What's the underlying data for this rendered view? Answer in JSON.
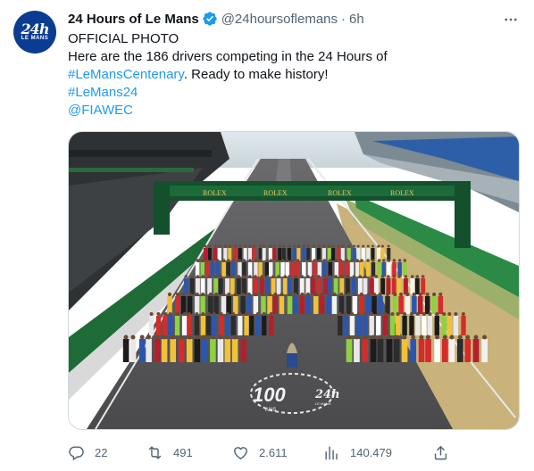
{
  "account": {
    "display_name": "24 Hours of Le Mans",
    "handle": "@24hoursoflemans",
    "separator": "·",
    "time": "6h",
    "avatar_text": "24h",
    "avatar_subtext": "LE MANS",
    "verified": true
  },
  "tweet": {
    "line1": "OFFICIAL PHOTO",
    "line2": "Here are the 186 drivers competing in the 24 Hours of",
    "hashtag_centenary": "#LeMansCentenary",
    "line3_rest": ". Ready to make history!",
    "hashtag_lemans24": "#LeMans24",
    "mention": "@FIAWEC"
  },
  "media": {
    "gantry_text": "ROLEX",
    "logo_number": "100",
    "logo_sub": "ANS",
    "logo_brand": "24h",
    "logo_brand_sub": "LE MANS"
  },
  "actions": {
    "replies": "22",
    "retweets": "491",
    "likes": "2.611",
    "views": "140.479"
  },
  "colors": {
    "link": "#1d9bf0",
    "secondary_text": "#536471",
    "verified": "#1d9bf0",
    "avatar_bg": "#0a3d91"
  },
  "icons": [
    "verified-badge-icon",
    "more-options-icon",
    "reply-icon",
    "retweet-icon",
    "like-icon",
    "views-icon",
    "share-icon"
  ]
}
